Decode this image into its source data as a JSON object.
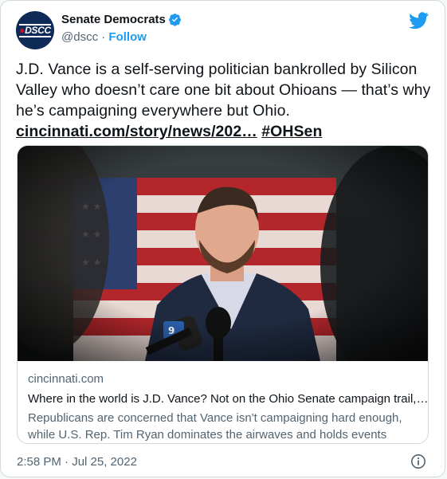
{
  "account": {
    "display_name": "Senate Democrats",
    "handle": "@dscc",
    "separator": "·",
    "follow_label": "Follow",
    "avatar_text": "DSCC"
  },
  "tweet": {
    "text": "J.D. Vance is a self-serving politician bankrolled by Silicon Valley who doesn’t care one bit about Ohioans — that’s why he’s campaigning everywhere but Ohio.",
    "link": "cincinnati.com/story/news/202…",
    "hashtag": "#OHSen",
    "timestamp": "2:58 PM · Jul 25, 2022"
  },
  "card": {
    "domain": "cincinnati.com",
    "title": "Where in the world is J.D. Vance? Not on the Ohio Senate campaign trail,…",
    "description": "Republicans are concerned that Vance isn't campaigning hard enough, while U.S. Rep. Tim Ryan dominates the airwaves and holds events acros…"
  },
  "icons": {
    "verified": "verified-badge-icon",
    "platform": "twitter-bird-icon",
    "info": "info-icon"
  },
  "colors": {
    "accent": "#1d9bf0",
    "text": "#0f1419",
    "muted": "#536471",
    "border": "#cfd9de"
  }
}
